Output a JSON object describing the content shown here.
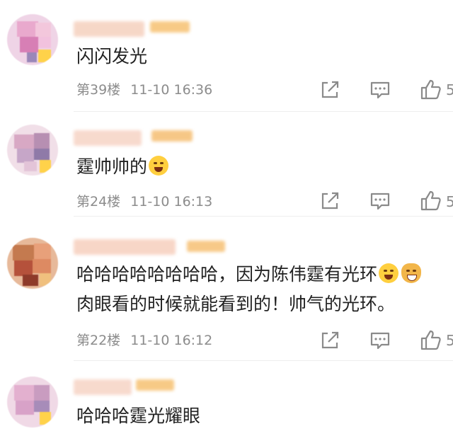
{
  "comments": [
    {
      "text": "闪闪发光",
      "floor": "第39楼",
      "time": "11-10 16:36",
      "likes": "5"
    },
    {
      "text": "霆帅帅的",
      "floor": "第24楼",
      "time": "11-10 16:13",
      "likes": "5"
    },
    {
      "text_line1": "哈哈哈哈哈哈哈哈，因为陈伟霆有光环",
      "text_line2": "肉眼看的时候就能看到的！帅气的光环。",
      "floor": "第22楼",
      "time": "11-10 16:12",
      "likes": "5"
    },
    {
      "text": "哈哈哈霆光耀眼"
    }
  ],
  "icons": {
    "repost": "share-icon",
    "comment": "comment-icon",
    "like": "thumbs-up-icon"
  },
  "colors": {
    "text": "#222222",
    "meta": "#8c8c8c",
    "icon": "#8a8a8a"
  }
}
